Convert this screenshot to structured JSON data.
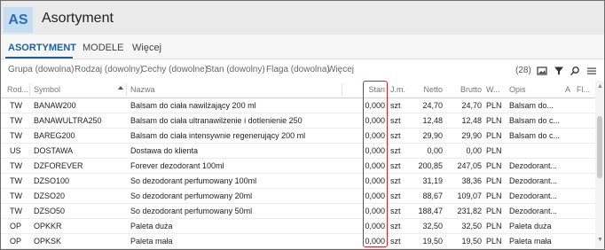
{
  "app": {
    "badge": "AS",
    "title": "Asortyment"
  },
  "tabs": [
    {
      "label": "ASORTYMENT",
      "active": true
    },
    {
      "label": "MODELE",
      "active": false
    },
    {
      "label": "Więcej",
      "active": false
    }
  ],
  "filters": {
    "items": [
      "Grupa (dowolna)",
      "Rodzaj (dowolny)",
      "Cechy (dowolne)",
      "Stan (dowolny)",
      "Flaga (dowolna)",
      "Więcej"
    ],
    "count": "(28)"
  },
  "table": {
    "columns": [
      "Rod...",
      "Symbol",
      "Nazwa",
      "Stan",
      "J.m.",
      "Netto",
      "Brutto",
      "W...",
      "Opis",
      "A",
      "Fl..."
    ],
    "rows": [
      [
        "TW",
        "BANAW200",
        "Balsam do ciała nawilżający 200 ml",
        "0,000",
        "szt",
        "24,70",
        "24,70",
        "PLN",
        "Balsam do..."
      ],
      [
        "TW",
        "BANAWULTRA250",
        "Balsam do ciała ultranawilżenie i dotlenienie 250",
        "0,000",
        "szt",
        "12,48",
        "12,48",
        "PLN",
        "Balsam do c..."
      ],
      [
        "TW",
        "BAREG200",
        "Balsam do ciała intensywnie regenerujący 200 ml",
        "0,000",
        "szt",
        "29,90",
        "29,90",
        "PLN",
        "Balsam do c..."
      ],
      [
        "US",
        "DOSTAWA",
        "Dostawa do klienta",
        "0,000",
        "szt",
        "0,00",
        "0,00",
        "PLN",
        ""
      ],
      [
        "TW",
        "DZFOREVER",
        "Forever dezodorant 100ml",
        "0,000",
        "szt",
        "200,85",
        "247,05",
        "PLN",
        "Dezodorant..."
      ],
      [
        "TW",
        "DZSO100",
        "So dezodorant perfumowany 100ml",
        "0,000",
        "szt",
        "31,19",
        "38,36",
        "PLN",
        "Dezodorant..."
      ],
      [
        "TW",
        "DZSO20",
        "So dezodorant perfumowany 20ml",
        "0,000",
        "szt",
        "88,67",
        "109,07",
        "PLN",
        "Dezodorant..."
      ],
      [
        "TW",
        "DZSO50",
        "So dezodorant perfumowany 50ml",
        "0,000",
        "szt",
        "188,47",
        "231,82",
        "PLN",
        "Dezodorant..."
      ],
      [
        "OP",
        "OPKKR",
        "Paleta duża",
        "0,000",
        "szt",
        "32,50",
        "32,50",
        "PLN",
        "Paleta duża"
      ],
      [
        "OP",
        "OPKSK",
        "Paleta mała",
        "0,000",
        "szt",
        "19,50",
        "19,50",
        "PLN",
        "Paleta mała"
      ]
    ]
  },
  "colors": {
    "accent": "#1f5f9c",
    "highlight": "#e02020",
    "badge_bg": "#c6ddf2"
  },
  "icons": [
    "image-icon",
    "filter-icon",
    "search-icon",
    "menu-icon"
  ]
}
